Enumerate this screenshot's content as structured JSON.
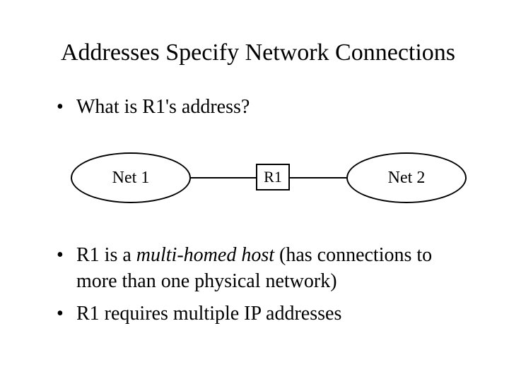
{
  "title": "Addresses Specify Network Connections",
  "bullet1": "What is R1's address?",
  "diagram": {
    "left_label": "Net 1",
    "router_label": "R1",
    "right_label": "Net 2"
  },
  "bullet2_prefix": "R1 is a ",
  "bullet2_italic": "multi-homed host",
  "bullet2_suffix": "  (has connections to more than one physical network)",
  "bullet3": "R1 requires multiple IP addresses"
}
